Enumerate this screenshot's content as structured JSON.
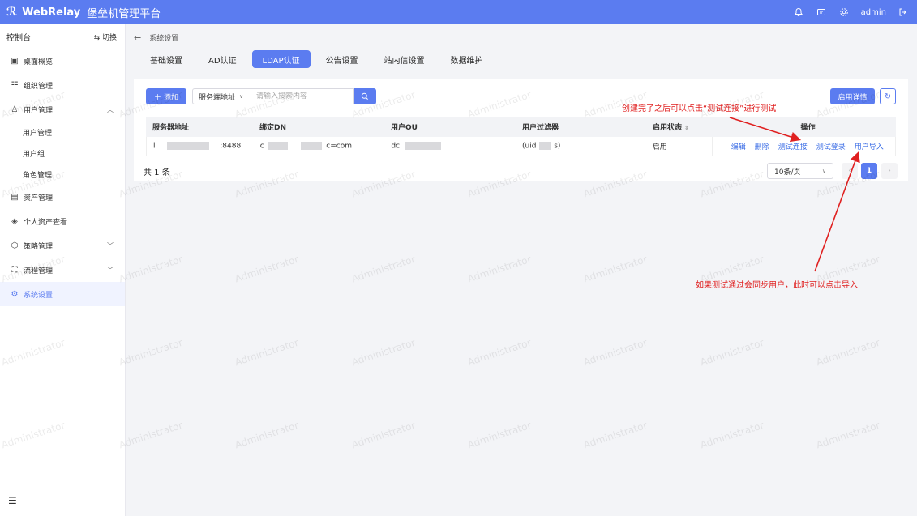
{
  "header": {
    "brand": "WebRelay",
    "title": "堡垒机管理平台",
    "user": "admin"
  },
  "sidebar": {
    "title": "控制台",
    "switch_label": "切换",
    "items": [
      {
        "label": "桌面概览",
        "icon": "monitor-icon"
      },
      {
        "label": "组织管理",
        "icon": "org-tree-icon"
      },
      {
        "label": "用户管理",
        "icon": "users-icon"
      },
      {
        "label": "资产管理",
        "icon": "asset-doc-icon"
      },
      {
        "label": "个人资产查看",
        "icon": "layers-icon"
      },
      {
        "label": "策略管理",
        "icon": "cube-icon"
      },
      {
        "label": "流程管理",
        "icon": "flow-icon"
      },
      {
        "label": "系统设置",
        "icon": "gear-icon"
      }
    ],
    "user_submenu": [
      "用户管理",
      "用户组",
      "角色管理"
    ]
  },
  "breadcrumb": "系统设置",
  "tabs": [
    "基础设置",
    "AD认证",
    "LDAP认证",
    "公告设置",
    "站内信设置",
    "数据维护"
  ],
  "active_tab": "LDAP认证",
  "toolbar": {
    "add_label": "添加",
    "search_field": "服务端地址",
    "search_placeholder": "请输入搜索内容",
    "detail_label": "启用详情"
  },
  "table": {
    "headers": [
      "服务器地址",
      "绑定DN",
      "用户OU",
      "用户过滤器",
      "启用状态",
      "操作"
    ],
    "rows": [
      {
        "server_prefix": "l",
        "server_suffix": ":8488",
        "dn_prefix": "c",
        "dn_suffix": "c=com",
        "ou_prefix": "dc",
        "filter_prefix": "(uid",
        "filter_suffix": "s)",
        "status": "启用",
        "actions": [
          "编辑",
          "删除",
          "测试连接",
          "测试登录",
          "用户导入"
        ]
      }
    ]
  },
  "pagination": {
    "total": "共 1 条",
    "page_size": "10条/页",
    "current_page": "1"
  },
  "annotations": {
    "note1": "创建完了之后可以点击“测试连接”进行测试",
    "note2": "如果测试通过会同步用户，此时可以点击导入"
  },
  "watermark": "Administrator",
  "colors": {
    "primary": "#5b7cf0",
    "annotation": "#e02020",
    "link": "#3c6ee6"
  }
}
